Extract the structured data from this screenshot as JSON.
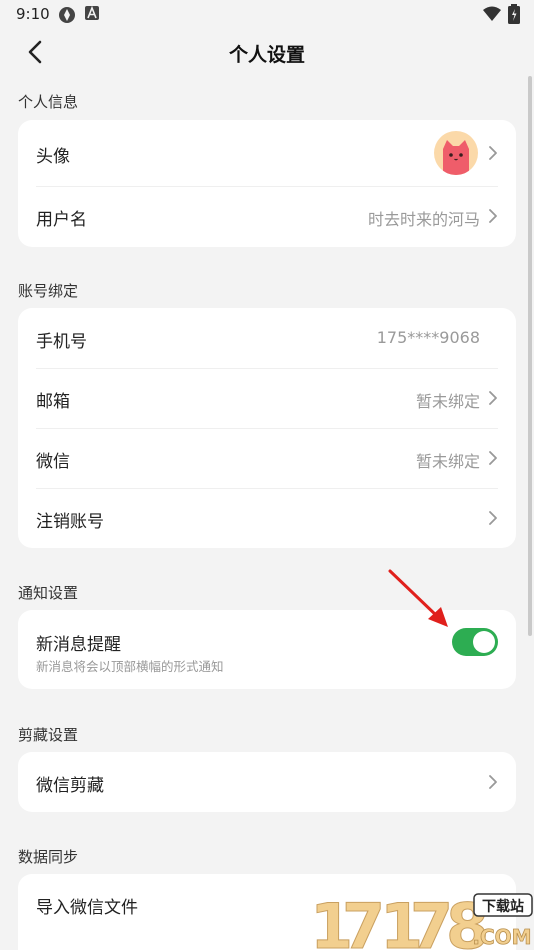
{
  "status_bar": {
    "time": "9:10"
  },
  "header": {
    "title": "个人设置"
  },
  "sections": {
    "personal_info": {
      "label": "个人信息",
      "avatar_label": "头像",
      "username_label": "用户名",
      "username_value": "时去时来的河马"
    },
    "account_binding": {
      "label": "账号绑定",
      "phone_label": "手机号",
      "phone_value": "175****9068",
      "email_label": "邮箱",
      "email_value": "暂未绑定",
      "wechat_label": "微信",
      "wechat_value": "暂未绑定",
      "delete_label": "注销账号"
    },
    "notification": {
      "label": "通知设置",
      "new_msg_label": "新消息提醒",
      "new_msg_desc": "新消息将会以顶部横幅的形式通知",
      "new_msg_enabled": true
    },
    "clip": {
      "label": "剪藏设置",
      "wechat_clip_label": "微信剪藏"
    },
    "sync": {
      "label": "数据同步",
      "import_label": "导入微信文件"
    }
  },
  "watermark": {
    "text": "17178",
    "sub": "下载站",
    "domain": ".COM"
  },
  "colors": {
    "accent_green": "#2dad52",
    "arrow_red": "#e0201c",
    "background": "#f3f3f3"
  }
}
